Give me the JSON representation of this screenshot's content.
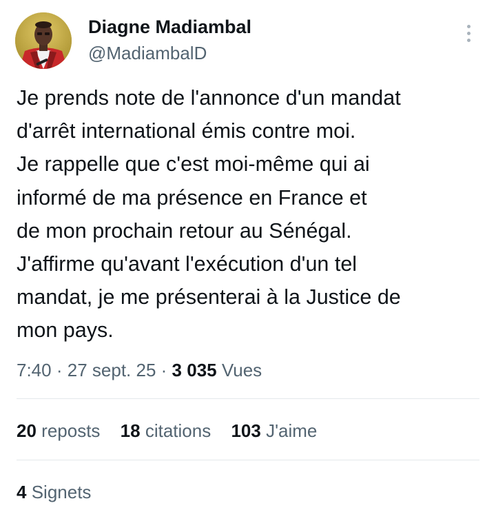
{
  "author": {
    "name": "Diagne Madiambal",
    "handle": "@MadiambalD",
    "avatar_icon": "profile-photo"
  },
  "tweet": {
    "lines": [
      "Je prends note de l'annonce d'un mandat",
      "d'arrêt international émis contre moi.",
      "Je rappelle que c'est moi-même qui ai",
      "informé de ma présence en France et",
      "de mon prochain retour au Sénégal.",
      "J'affirme qu'avant l'exécution d'un tel",
      "mandat, je me présenterai à la Justice de",
      "mon pays."
    ]
  },
  "meta": {
    "time": "7:40",
    "separator": "·",
    "date": "27 sept. 25",
    "views_count": "3 035",
    "views_label": "Vues"
  },
  "stats": {
    "reposts_count": "20",
    "reposts_label": "reposts",
    "quotes_count": "18",
    "quotes_label": "citations",
    "likes_count": "103",
    "likes_label": "J'aime",
    "bookmarks_count": "4",
    "bookmarks_label": "Signets"
  },
  "colors": {
    "text_primary": "#0f1419",
    "text_secondary": "#536471",
    "divider": "#e4e8eb"
  },
  "icons": {
    "more": "more-vertical-icon"
  }
}
